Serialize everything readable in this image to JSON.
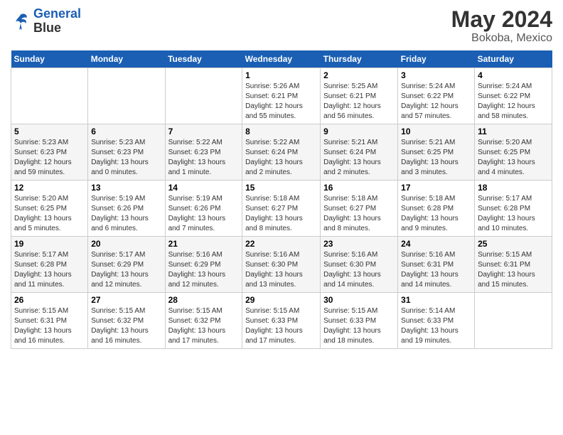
{
  "logo": {
    "line1": "General",
    "line2": "Blue"
  },
  "title": "May 2024",
  "subtitle": "Bokoba, Mexico",
  "days_header": [
    "Sunday",
    "Monday",
    "Tuesday",
    "Wednesday",
    "Thursday",
    "Friday",
    "Saturday"
  ],
  "weeks": [
    [
      {
        "num": "",
        "info": ""
      },
      {
        "num": "",
        "info": ""
      },
      {
        "num": "",
        "info": ""
      },
      {
        "num": "1",
        "info": "Sunrise: 5:26 AM\nSunset: 6:21 PM\nDaylight: 12 hours\nand 55 minutes."
      },
      {
        "num": "2",
        "info": "Sunrise: 5:25 AM\nSunset: 6:21 PM\nDaylight: 12 hours\nand 56 minutes."
      },
      {
        "num": "3",
        "info": "Sunrise: 5:24 AM\nSunset: 6:22 PM\nDaylight: 12 hours\nand 57 minutes."
      },
      {
        "num": "4",
        "info": "Sunrise: 5:24 AM\nSunset: 6:22 PM\nDaylight: 12 hours\nand 58 minutes."
      }
    ],
    [
      {
        "num": "5",
        "info": "Sunrise: 5:23 AM\nSunset: 6:23 PM\nDaylight: 12 hours\nand 59 minutes."
      },
      {
        "num": "6",
        "info": "Sunrise: 5:23 AM\nSunset: 6:23 PM\nDaylight: 13 hours\nand 0 minutes."
      },
      {
        "num": "7",
        "info": "Sunrise: 5:22 AM\nSunset: 6:23 PM\nDaylight: 13 hours\nand 1 minute."
      },
      {
        "num": "8",
        "info": "Sunrise: 5:22 AM\nSunset: 6:24 PM\nDaylight: 13 hours\nand 2 minutes."
      },
      {
        "num": "9",
        "info": "Sunrise: 5:21 AM\nSunset: 6:24 PM\nDaylight: 13 hours\nand 2 minutes."
      },
      {
        "num": "10",
        "info": "Sunrise: 5:21 AM\nSunset: 6:25 PM\nDaylight: 13 hours\nand 3 minutes."
      },
      {
        "num": "11",
        "info": "Sunrise: 5:20 AM\nSunset: 6:25 PM\nDaylight: 13 hours\nand 4 minutes."
      }
    ],
    [
      {
        "num": "12",
        "info": "Sunrise: 5:20 AM\nSunset: 6:25 PM\nDaylight: 13 hours\nand 5 minutes."
      },
      {
        "num": "13",
        "info": "Sunrise: 5:19 AM\nSunset: 6:26 PM\nDaylight: 13 hours\nand 6 minutes."
      },
      {
        "num": "14",
        "info": "Sunrise: 5:19 AM\nSunset: 6:26 PM\nDaylight: 13 hours\nand 7 minutes."
      },
      {
        "num": "15",
        "info": "Sunrise: 5:18 AM\nSunset: 6:27 PM\nDaylight: 13 hours\nand 8 minutes."
      },
      {
        "num": "16",
        "info": "Sunrise: 5:18 AM\nSunset: 6:27 PM\nDaylight: 13 hours\nand 8 minutes."
      },
      {
        "num": "17",
        "info": "Sunrise: 5:18 AM\nSunset: 6:28 PM\nDaylight: 13 hours\nand 9 minutes."
      },
      {
        "num": "18",
        "info": "Sunrise: 5:17 AM\nSunset: 6:28 PM\nDaylight: 13 hours\nand 10 minutes."
      }
    ],
    [
      {
        "num": "19",
        "info": "Sunrise: 5:17 AM\nSunset: 6:28 PM\nDaylight: 13 hours\nand 11 minutes."
      },
      {
        "num": "20",
        "info": "Sunrise: 5:17 AM\nSunset: 6:29 PM\nDaylight: 13 hours\nand 12 minutes."
      },
      {
        "num": "21",
        "info": "Sunrise: 5:16 AM\nSunset: 6:29 PM\nDaylight: 13 hours\nand 12 minutes."
      },
      {
        "num": "22",
        "info": "Sunrise: 5:16 AM\nSunset: 6:30 PM\nDaylight: 13 hours\nand 13 minutes."
      },
      {
        "num": "23",
        "info": "Sunrise: 5:16 AM\nSunset: 6:30 PM\nDaylight: 13 hours\nand 14 minutes."
      },
      {
        "num": "24",
        "info": "Sunrise: 5:16 AM\nSunset: 6:31 PM\nDaylight: 13 hours\nand 14 minutes."
      },
      {
        "num": "25",
        "info": "Sunrise: 5:15 AM\nSunset: 6:31 PM\nDaylight: 13 hours\nand 15 minutes."
      }
    ],
    [
      {
        "num": "26",
        "info": "Sunrise: 5:15 AM\nSunset: 6:31 PM\nDaylight: 13 hours\nand 16 minutes."
      },
      {
        "num": "27",
        "info": "Sunrise: 5:15 AM\nSunset: 6:32 PM\nDaylight: 13 hours\nand 16 minutes."
      },
      {
        "num": "28",
        "info": "Sunrise: 5:15 AM\nSunset: 6:32 PM\nDaylight: 13 hours\nand 17 minutes."
      },
      {
        "num": "29",
        "info": "Sunrise: 5:15 AM\nSunset: 6:33 PM\nDaylight: 13 hours\nand 17 minutes."
      },
      {
        "num": "30",
        "info": "Sunrise: 5:15 AM\nSunset: 6:33 PM\nDaylight: 13 hours\nand 18 minutes."
      },
      {
        "num": "31",
        "info": "Sunrise: 5:14 AM\nSunset: 6:33 PM\nDaylight: 13 hours\nand 19 minutes."
      },
      {
        "num": "",
        "info": ""
      }
    ]
  ]
}
